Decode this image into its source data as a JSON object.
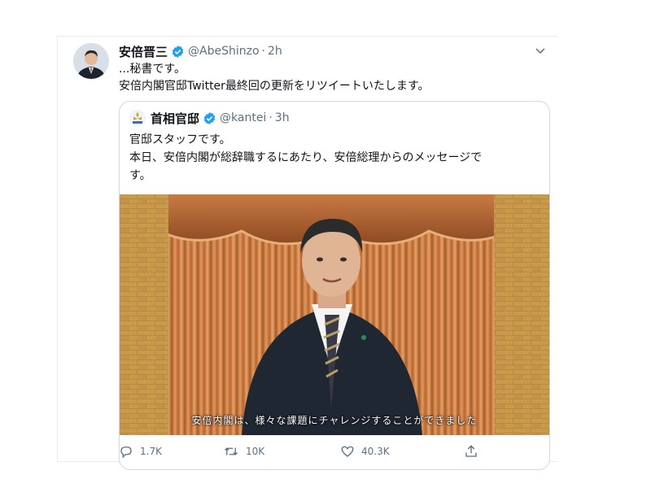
{
  "tweet": {
    "author": {
      "display_name": "安倍晋三",
      "handle": "@AbeShinzo",
      "separator": "·",
      "time": "2h"
    },
    "text_lines": [
      "...秘書です。",
      "安倍内閣官邸Twitter最終回の更新をリツイートいたします。"
    ],
    "quoted": {
      "author": {
        "display_name": "首相官邸",
        "handle": "@kantei",
        "separator": "·",
        "time": "3h"
      },
      "text_lines": [
        "官邸スタッフです。",
        "本日、安倍内閣が総辞職するにあたり、安倍総理からのメッセージで",
        "す。"
      ],
      "video_subtitle": "安倍内閣は、様々な課題にチャレンジすることができました"
    },
    "actions": {
      "replies": "1.7K",
      "retweets": "10K",
      "likes": "40.3K"
    }
  },
  "icons": {
    "verified": "verified-badge-icon",
    "menu": "chevron-down-icon",
    "reply": "reply-icon",
    "retweet": "retweet-icon",
    "like": "heart-icon",
    "share": "share-icon"
  },
  "colors": {
    "verified": "#1da1f2",
    "secondary_text": "#5b7083",
    "border": "#cfd9de"
  }
}
